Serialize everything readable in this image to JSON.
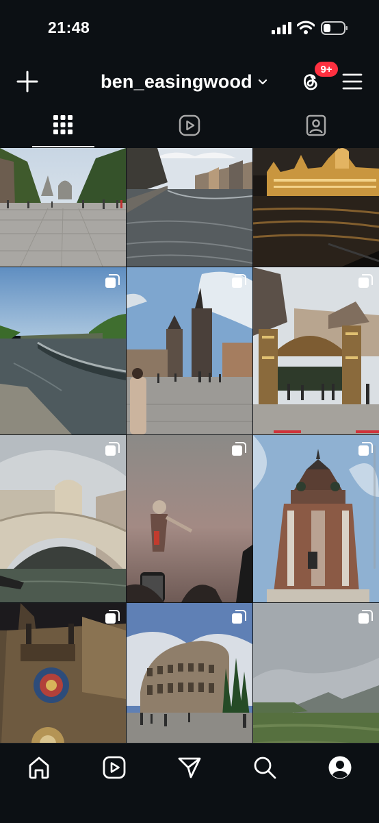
{
  "status_bar": {
    "time": "21:48"
  },
  "header": {
    "username": "ben_easingwood",
    "threads_badge": "9+",
    "icons": [
      "plus-icon",
      "chevron-down-icon",
      "threads-icon",
      "menu-icon"
    ]
  },
  "tabs": [
    {
      "name": "posts-grid",
      "icon": "grid-icon",
      "active": true
    },
    {
      "name": "reels",
      "icon": "reels-icon",
      "active": false
    },
    {
      "name": "tagged",
      "icon": "tagged-person-icon",
      "active": false
    }
  ],
  "posts": [
    {
      "subject": "Wenceslas Square, Prague",
      "multi": false
    },
    {
      "subject": "Canal with buildings",
      "multi": false
    },
    {
      "subject": "Hungarian Parliament at night",
      "multi": false
    },
    {
      "subject": "River weir",
      "multi": true
    },
    {
      "subject": "Charles Bridge tower",
      "multi": true
    },
    {
      "subject": "Christmas market gate",
      "multi": true
    },
    {
      "subject": "Rialto Bridge, Venice",
      "multi": true
    },
    {
      "subject": "Concert crowd",
      "multi": true
    },
    {
      "subject": "Town hall tower",
      "multi": true
    },
    {
      "subject": "Astronomical clock",
      "multi": true
    },
    {
      "subject": "Colosseum, Rome",
      "multi": true
    },
    {
      "subject": "Green hills landscape",
      "multi": true
    }
  ],
  "bottom_nav": [
    "home-icon",
    "reels-icon",
    "messages-icon",
    "search-icon",
    "profile-icon"
  ],
  "colors": {
    "background": "#0c1014",
    "badge": "#ff3040",
    "text": "#ffffff"
  }
}
